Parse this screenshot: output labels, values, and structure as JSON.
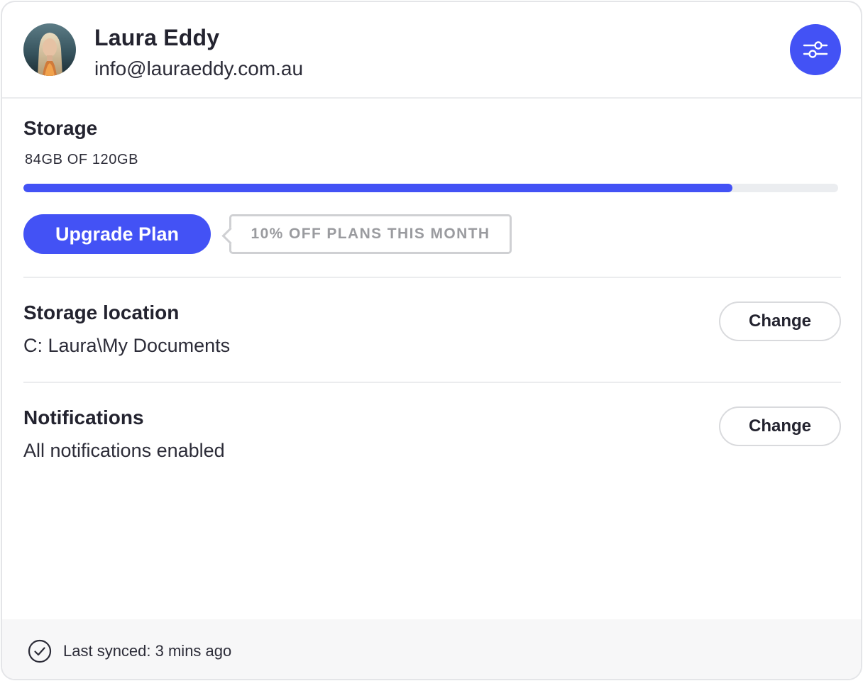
{
  "profile": {
    "name": "Laura Eddy",
    "email": "info@lauraeddy.com.au",
    "avatar_icon": "user-photo"
  },
  "header": {
    "settings_icon": "sliders-icon"
  },
  "storage": {
    "title": "Storage",
    "usage_text": "84GB OF 120GB",
    "used_fraction": 0.87,
    "upgrade_label": "Upgrade Plan",
    "promo_text": "10% OFF PLANS THIS MONTH"
  },
  "storage_location": {
    "title": "Storage location",
    "value": "C: Laura\\My Documents",
    "button_label": "Change"
  },
  "notifications": {
    "title": "Notifications",
    "value": "All notifications enabled",
    "button_label": "Change"
  },
  "footer": {
    "sync_icon": "check-circle-icon",
    "sync_text": "Last synced: 3 mins ago"
  },
  "colors": {
    "accent": "#4352f5",
    "track": "#ebedf0",
    "text": "#23232f",
    "footer_bg": "#f7f7f8"
  }
}
